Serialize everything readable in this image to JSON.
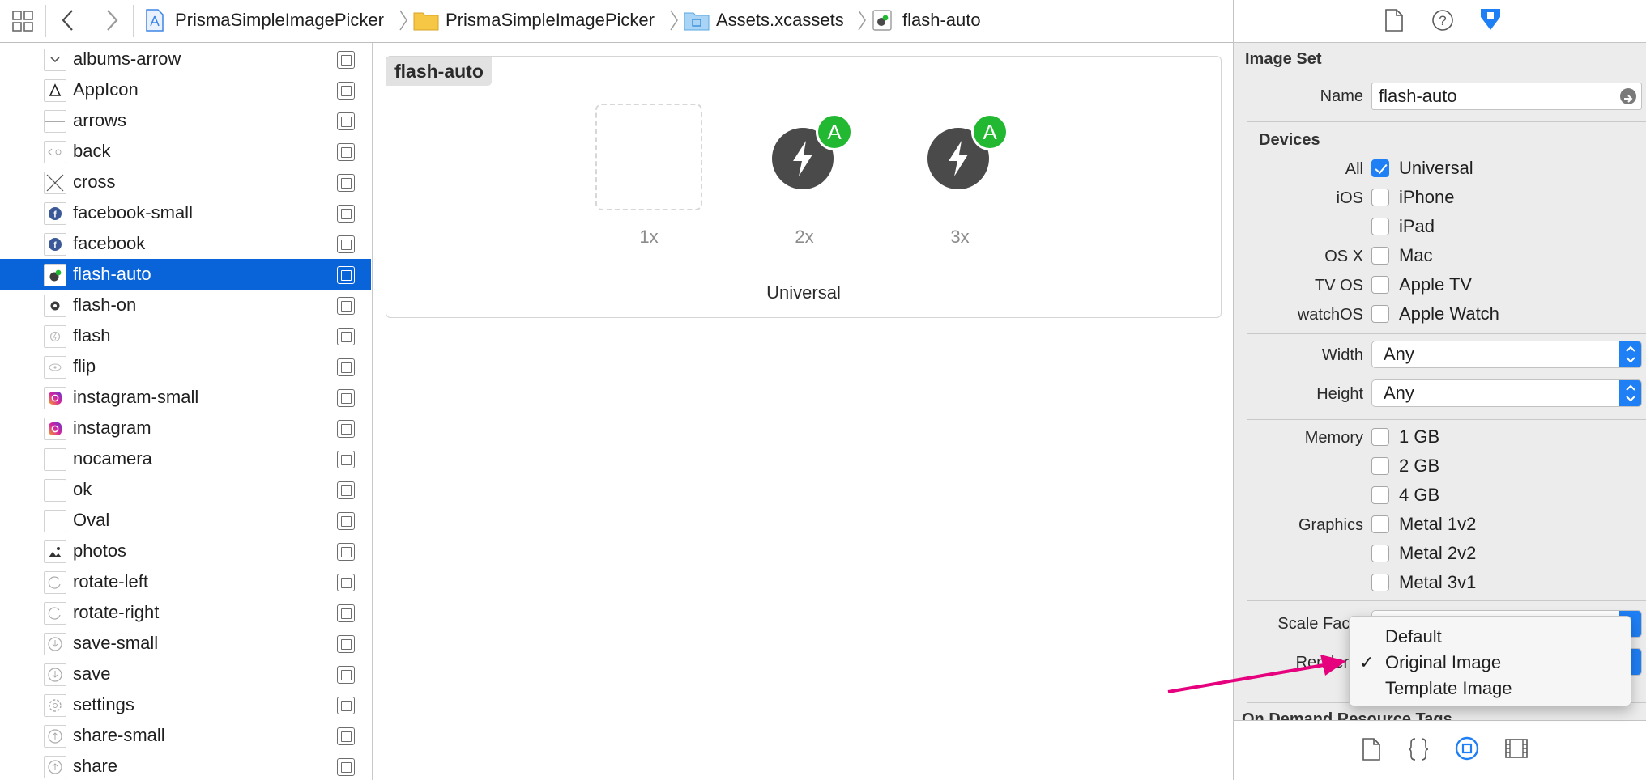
{
  "breadcrumb": [
    "PrismaSimpleImagePicker",
    "PrismaSimpleImagePicker",
    "Assets.xcassets",
    "flash-auto"
  ],
  "toolbar_icons": [
    "grid-icon",
    "back-chevron-icon",
    "forward-chevron-icon"
  ],
  "asset_list": [
    {
      "name": "albums-arrow",
      "icon": "chevron-thumb"
    },
    {
      "name": "AppIcon",
      "icon": "appicon-thumb"
    },
    {
      "name": "arrows",
      "icon": "line-thumb"
    },
    {
      "name": "back",
      "icon": "back-thumb"
    },
    {
      "name": "cross",
      "icon": "cross-thumb"
    },
    {
      "name": "facebook-small",
      "icon": "facebook-thumb"
    },
    {
      "name": "facebook",
      "icon": "facebook-thumb"
    },
    {
      "name": "flash-auto",
      "icon": "flash-auto-thumb"
    },
    {
      "name": "flash-on",
      "icon": "flash-on-thumb"
    },
    {
      "name": "flash",
      "icon": "flash-thumb"
    },
    {
      "name": "flip",
      "icon": "flip-thumb"
    },
    {
      "name": "instagram-small",
      "icon": "instagram-thumb"
    },
    {
      "name": "instagram",
      "icon": "instagram-thumb"
    },
    {
      "name": "nocamera",
      "icon": "blank-thumb"
    },
    {
      "name": "ok",
      "icon": "blank-thumb"
    },
    {
      "name": "Oval",
      "icon": "blank-thumb"
    },
    {
      "name": "photos",
      "icon": "photos-thumb"
    },
    {
      "name": "rotate-left",
      "icon": "rotate-thumb"
    },
    {
      "name": "rotate-right",
      "icon": "rotate-thumb"
    },
    {
      "name": "save-small",
      "icon": "save-thumb"
    },
    {
      "name": "save",
      "icon": "save-thumb"
    },
    {
      "name": "settings",
      "icon": "settings-thumb"
    },
    {
      "name": "share-small",
      "icon": "share-thumb"
    },
    {
      "name": "share",
      "icon": "share-thumb"
    }
  ],
  "selected_asset": "flash-auto",
  "editor": {
    "image_set_title": "flash-auto",
    "slots": [
      "1x",
      "2x",
      "3x"
    ],
    "badge_letter": "A",
    "group_label": "Universal"
  },
  "inspector": {
    "section_image_set": "Image Set",
    "name_label": "Name",
    "name_value": "flash-auto",
    "section_devices": "Devices",
    "devices": [
      {
        "group": "All",
        "option": "Universal",
        "checked": true
      },
      {
        "group": "iOS",
        "option": "iPhone",
        "checked": false
      },
      {
        "group": "",
        "option": "iPad",
        "checked": false
      },
      {
        "group": "OS X",
        "option": "Mac",
        "checked": false
      },
      {
        "group": "TV OS",
        "option": "Apple TV",
        "checked": false
      },
      {
        "group": "watchOS",
        "option": "Apple Watch",
        "checked": false
      }
    ],
    "width_label": "Width",
    "width_value": "Any",
    "height_label": "Height",
    "height_value": "Any",
    "memory_label": "Memory",
    "memory": [
      "1 GB",
      "2 GB",
      "4 GB"
    ],
    "graphics_label": "Graphics",
    "graphics": [
      "Metal 1v2",
      "Metal 2v2",
      "Metal 3v1"
    ],
    "scale_label": "Scale Facto",
    "render_label": "Render A",
    "odr_label": "On Demand Resource Tags"
  },
  "render_menu": {
    "items": [
      "Default",
      "Original Image",
      "Template Image"
    ],
    "checked": "Original Image",
    "check_mark": "✓"
  },
  "colors": {
    "selection": "#0a64d9",
    "accent": "#1f7ff5",
    "badge": "#22b832",
    "arrow": "#e6007e"
  }
}
